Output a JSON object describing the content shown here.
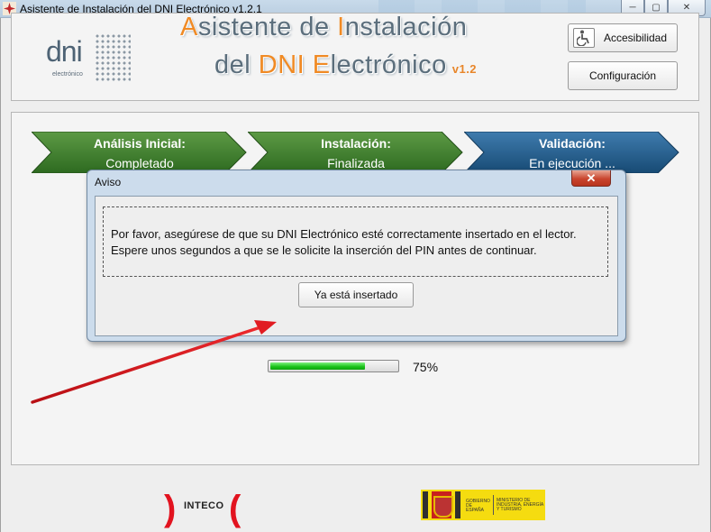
{
  "window": {
    "title": "Asistente de Instalación del DNI Electrónico v1.2.1",
    "minimize": "─",
    "maximize": "▢",
    "close": "✕"
  },
  "header": {
    "logo_text": "dni",
    "logo_subtext": "electrónico",
    "title_line1_prefix": "A",
    "title_line1_rest1": "sistente de ",
    "title_line1_hl2": "I",
    "title_line1_rest2": "nstalación",
    "title_line2_prefix": "del ",
    "title_line2_mid": "DNI ",
    "title_line2_hl": "E",
    "title_line2_rest": "lectrónico",
    "version": "v1.2",
    "accessibility_button": "Accesibilidad",
    "config_button": "Configuración"
  },
  "steps": [
    {
      "title": "Análisis Inicial:",
      "status": "Completado",
      "color": "#3b7a2a"
    },
    {
      "title": "Instalación:",
      "status": "Finalizada",
      "color": "#3b7a2a"
    },
    {
      "title": "Validación:",
      "status": "En ejecución ...",
      "color": "#1e5a87"
    }
  ],
  "dialog": {
    "title": "Aviso",
    "close": "✕",
    "message_line1": "Por favor, asegúrese de que su DNI Electrónico esté correctamente insertado en el lector.",
    "message_line2": "Espere unos segundos a que se le solicite la inserción del PIN antes de continuar.",
    "ok_button": "Ya está insertado"
  },
  "progress": {
    "value": 0.75,
    "label": "75%"
  },
  "footer": {
    "inteco": "INTECO",
    "gob_text1": "GOBIERNO DE ESPAÑA",
    "gob_text2": "MINISTERIO DE INDUSTRIA, ENERGÍA Y TURISMO"
  },
  "colors": {
    "accent_orange": "#f08a24",
    "annotation_arrow": "#d9141b"
  }
}
